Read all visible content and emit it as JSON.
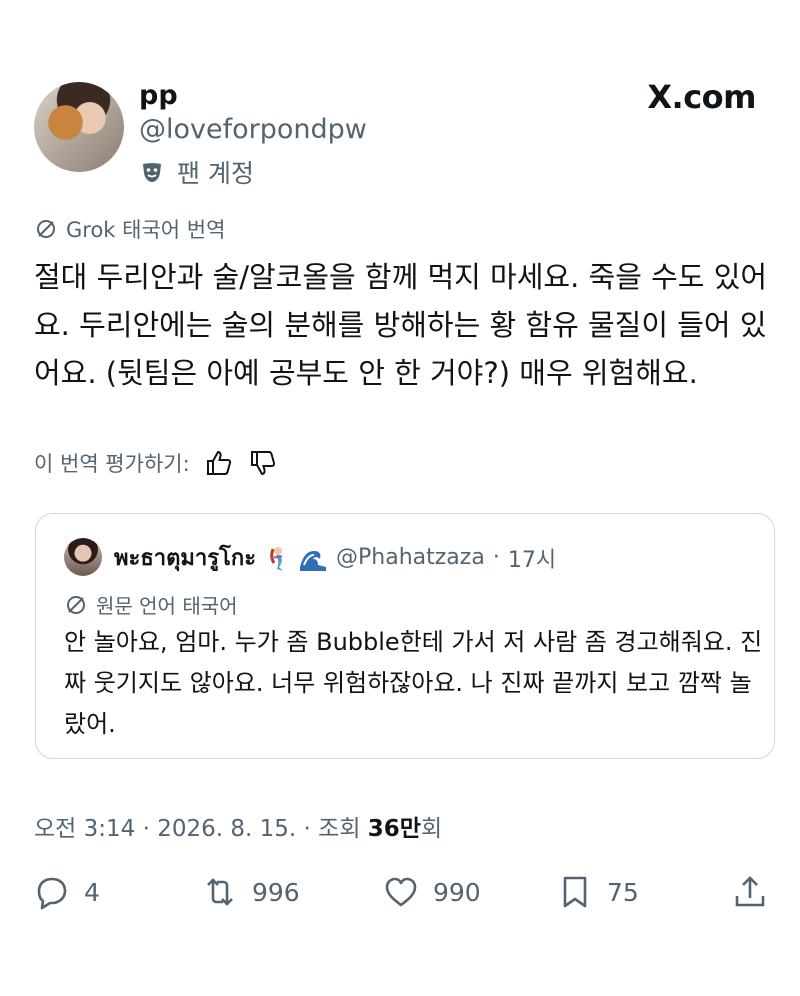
{
  "author": {
    "name": "pp",
    "handle": "@loveforpondpw",
    "badge_label": "팬 계정"
  },
  "brand": "X.com",
  "translation": {
    "label": "Grok 태국어 번역",
    "text": "절대 두리안과 술/알코올을 함께 먹지 마세요. 죽을 수도 있어요. 두리안에는 술의 분해를 방해하는 황 함유 물질이 들어 있어요. (뒷팀은 아예 공부도 안 한 거야?) 매우 위험해요.",
    "rate_label": "이 번역 평가하기:"
  },
  "quote": {
    "name": "พะธาตุมารูโกะ",
    "handle": "@Phahatzaza",
    "time": "17시",
    "orig_label": "원문 언어 태국어",
    "text": "안 놀아요, 엄마. 누가 좀 Bubble한테 가서 저 사람 좀 경고해줘요. 진짜 웃기지도 않아요. 너무 위험하잖아요. 나 진짜 끝까지 보고 깜짝 놀랐어."
  },
  "meta": {
    "time": "오전 3:14",
    "date": "2026. 8. 15.",
    "views_label": "조회",
    "views_count": "36만",
    "views_unit": "회"
  },
  "actions": {
    "replies": "4",
    "reposts": "996",
    "likes": "990",
    "bookmarks": "75"
  },
  "icons": [
    "theater-mask-icon",
    "block-icon",
    "thumbs-up-icon",
    "thumbs-down-icon",
    "reply-icon",
    "repost-icon",
    "like-icon",
    "bookmark-icon",
    "share-icon"
  ]
}
